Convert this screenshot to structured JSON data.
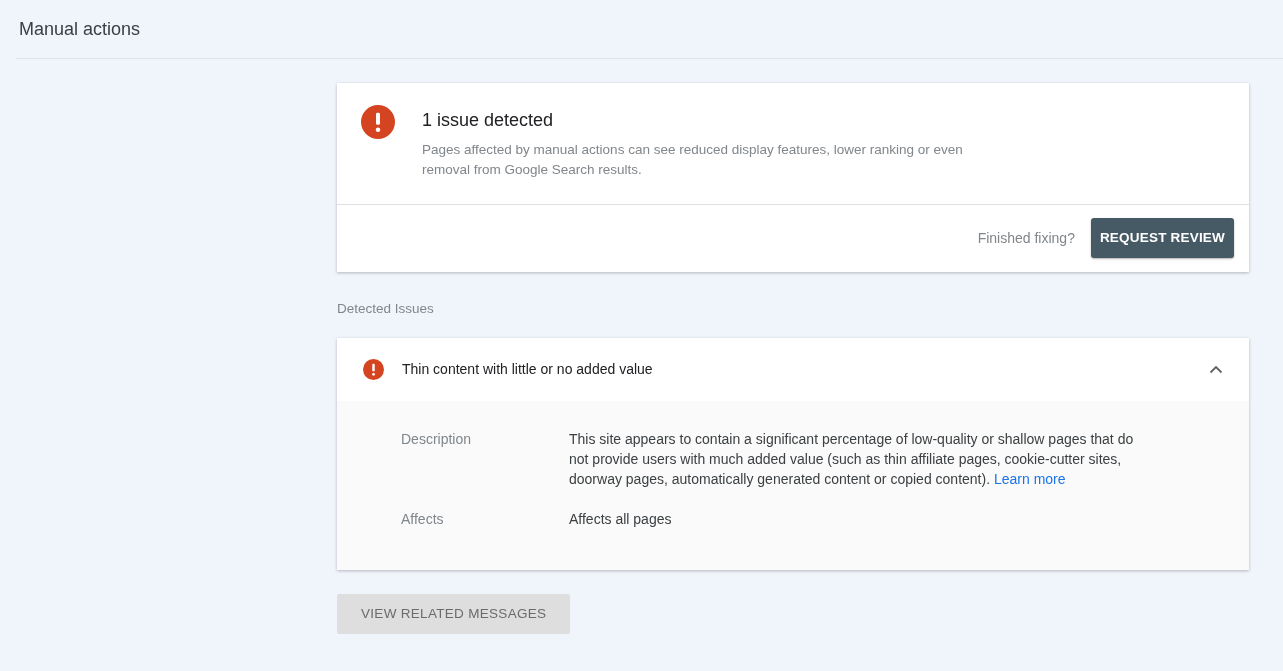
{
  "page": {
    "title": "Manual actions"
  },
  "summary": {
    "title": "1 issue detected",
    "text": "Pages affected by manual actions can see reduced display features, lower ranking or even removal from Google Search results.",
    "prompt": "Finished fixing?",
    "button": "REQUEST REVIEW"
  },
  "section_label": "Detected Issues",
  "issues": [
    {
      "title": "Thin content with little or no added value",
      "expanded": true,
      "details": [
        {
          "label": "Description",
          "text": "This site appears to contain a significant percentage of low-quality or shallow pages that do not provide users with much added value (such as thin affiliate pages, cookie-cutter sites, doorway pages, automatically generated content or copied content).",
          "link": "Learn more"
        },
        {
          "label": "Affects",
          "text": "Affects all pages"
        }
      ]
    }
  ],
  "related_button": {
    "label": "VIEW RELATED MESSAGES",
    "disabled": true
  }
}
